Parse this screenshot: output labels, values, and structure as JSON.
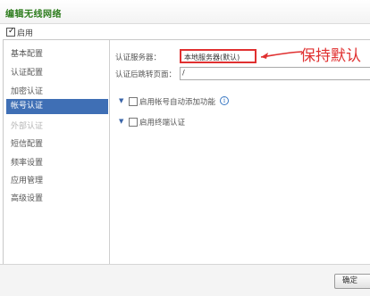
{
  "window": {
    "title": "编辑无线网络"
  },
  "enable": {
    "label": "启用",
    "checked": true
  },
  "sidebar": {
    "items": [
      {
        "label": "基本配置",
        "state": "normal"
      },
      {
        "label": "认证配置",
        "state": "normal"
      },
      {
        "label": "加密认证",
        "state": "normal"
      },
      {
        "label": "帐号认证",
        "state": "active"
      },
      {
        "label": "外部认证",
        "state": "disabled"
      },
      {
        "label": "短信配置",
        "state": "normal"
      },
      {
        "label": "频率设置",
        "state": "normal"
      },
      {
        "label": "应用管理",
        "state": "normal"
      },
      {
        "label": "高级设置",
        "state": "normal"
      }
    ]
  },
  "form": {
    "auth_server_label": "认证服务器：",
    "auth_server_value": "本地服务器(默认)",
    "redirect_label": "认证后跳转页面：",
    "redirect_value": "/",
    "option1_label": "启用帐号自动添加功能",
    "option2_label": "启用终端认证"
  },
  "annotation": {
    "text": "保持默认",
    "color": "#e03030"
  },
  "footer": {
    "button_label": "确定"
  },
  "colors": {
    "title": "#2f7d1f",
    "active_nav": "#3f6fb5",
    "highlight": "#e03030"
  }
}
